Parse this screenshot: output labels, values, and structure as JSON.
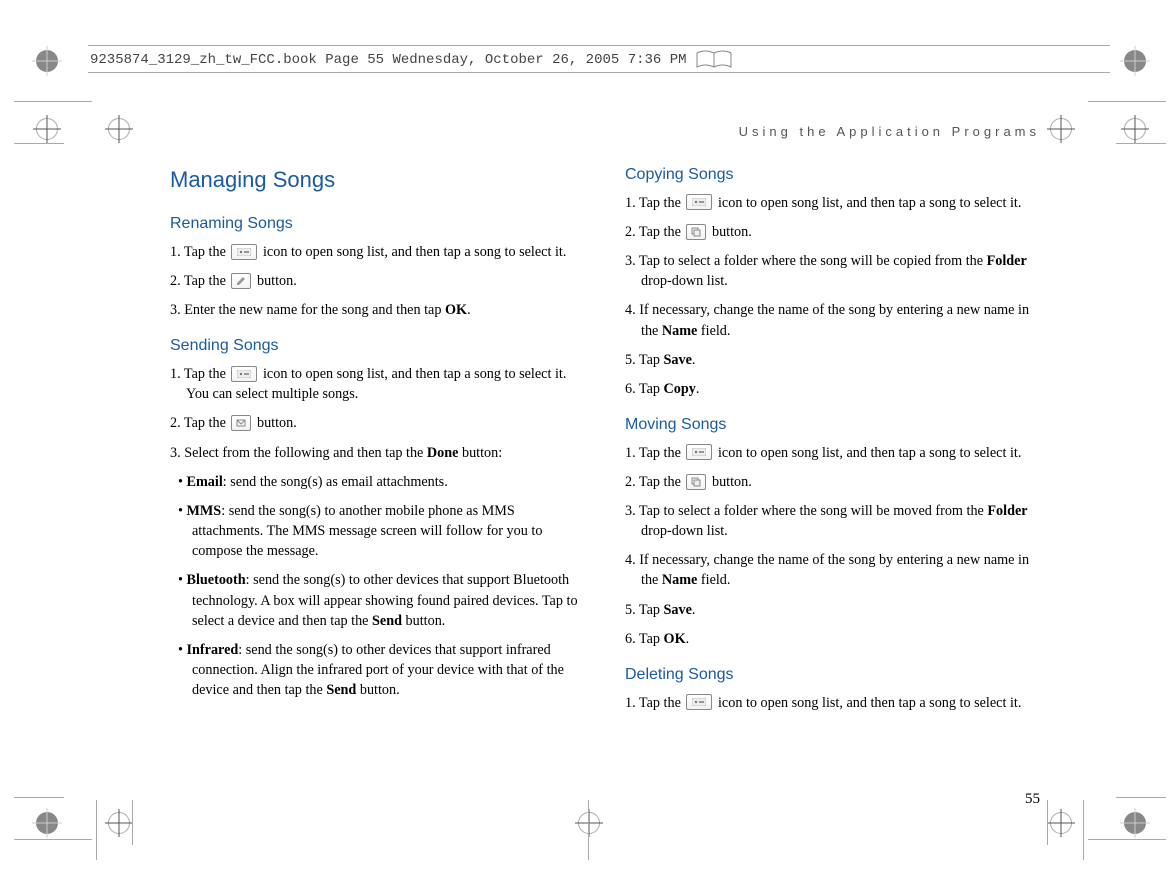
{
  "header": {
    "text": "9235874_3129_zh_tw_FCC.book  Page 55  Wednesday, October 26, 2005  7:36 PM"
  },
  "running_head": "Using the Application Programs",
  "page_number": "55",
  "left": {
    "h1": "Managing Songs",
    "renaming": {
      "title": "Renaming Songs",
      "s1a": "1. Tap the ",
      "s1b": " icon to open song list, and then tap a song to select it.",
      "s2a": "2. Tap the ",
      "s2b": " button.",
      "s3a": "3. Enter the new name for the song and then tap ",
      "s3b": "OK",
      "s3c": "."
    },
    "sending": {
      "title": "Sending Songs",
      "s1a": "1. Tap the ",
      "s1b": " icon to open song list, and then tap a song to select it. You can select multiple songs.",
      "s2a": "2. Tap the ",
      "s2b": " button.",
      "s3a": "3. Select from the following and then tap the ",
      "s3b": "Done",
      "s3c": " button:",
      "b1a": "• ",
      "b1b": "Email",
      "b1c": ": send the song(s) as email attachments.",
      "b2a": "• ",
      "b2b": "MMS",
      "b2c": ": send the song(s) to another mobile phone as MMS attachments. The MMS message screen will follow for you to compose the message.",
      "b3a": "• ",
      "b3b": "Bluetooth",
      "b3c": ": send the song(s) to other devices that support Bluetooth technology. A box will appear showing found paired devices. Tap to select a device and then tap the ",
      "b3d": "Send",
      "b3e": " button.",
      "b4a": "• ",
      "b4b": "Infrared",
      "b4c": ": send the song(s) to other devices that support infrared connection. Align the infrared port of your device with that of the device and then tap the ",
      "b4d": "Send",
      "b4e": " button."
    }
  },
  "right": {
    "copying": {
      "title": "Copying Songs",
      "s1a": "1. Tap the ",
      "s1b": " icon to open song list, and then tap a song to select it.",
      "s2a": "2. Tap the ",
      "s2b": " button.",
      "s3a": "3. Tap to select a folder where the song will be copied from the ",
      "s3b": "Folder",
      "s3c": " drop-down list.",
      "s4a": "4. If necessary, change the name of the song by entering a new name in the ",
      "s4b": "Name",
      "s4c": " field.",
      "s5a": "5. Tap ",
      "s5b": "Save",
      "s5c": ".",
      "s6a": "6. Tap ",
      "s6b": "Copy",
      "s6c": "."
    },
    "moving": {
      "title": "Moving Songs",
      "s1a": "1. Tap the ",
      "s1b": " icon to open song list, and then tap a song to select it.",
      "s2a": "2. Tap the ",
      "s2b": " button.",
      "s3a": "3. Tap to select a folder where the song will be moved from the ",
      "s3b": "Folder",
      "s3c": " drop-down list.",
      "s4a": "4. If necessary, change the name of the song by entering a new name in the ",
      "s4b": "Name",
      "s4c": " field.",
      "s5a": "5. Tap ",
      "s5b": "Save",
      "s5c": ".",
      "s6a": "6. Tap ",
      "s6b": "OK",
      "s6c": "."
    },
    "deleting": {
      "title": "Deleting Songs",
      "s1a": "1. Tap the ",
      "s1b": " icon to open song list, and then tap a song to select it."
    }
  }
}
